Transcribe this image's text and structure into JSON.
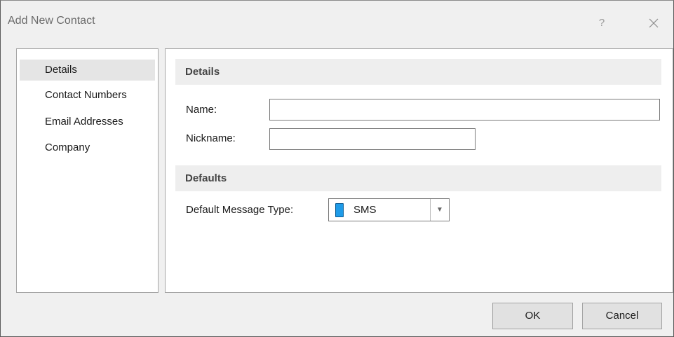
{
  "window": {
    "title": "Add New Contact",
    "help_label": "?",
    "close_icon": "close-icon"
  },
  "nav": {
    "items": [
      {
        "label": "Details",
        "selected": true
      },
      {
        "label": "Contact Numbers",
        "selected": false
      },
      {
        "label": "Email Addresses",
        "selected": false
      },
      {
        "label": "Company",
        "selected": false
      }
    ]
  },
  "details_section": {
    "header": "Details",
    "name_label": "Name:",
    "name_value": "",
    "nickname_label": "Nickname:",
    "nickname_value": ""
  },
  "defaults_section": {
    "header": "Defaults",
    "message_type_label": "Default Message Type:",
    "message_type_value": "SMS",
    "message_type_icon": "sms-phone-icon",
    "message_type_icon_color": "#1e9be8"
  },
  "buttons": {
    "ok_label": "OK",
    "cancel_label": "Cancel"
  }
}
